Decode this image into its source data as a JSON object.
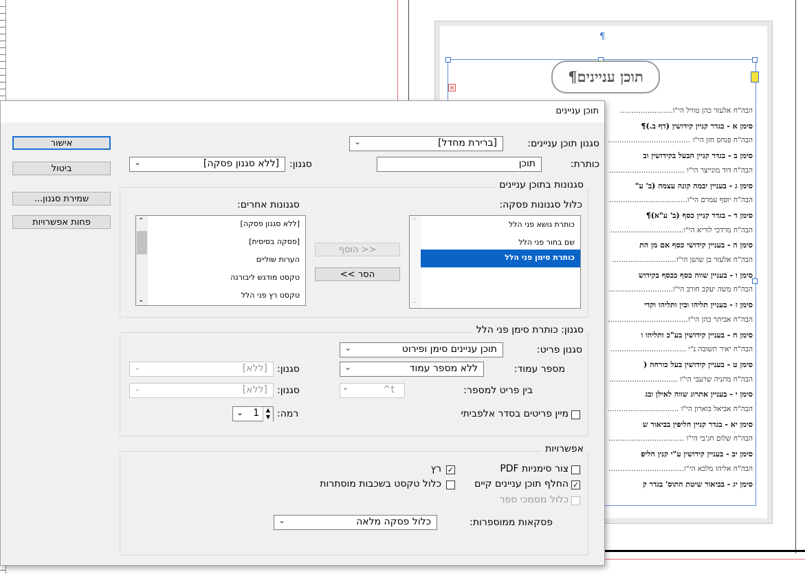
{
  "document": {
    "pilcrow": "¶",
    "title_banner": "תוכן עניינים¶",
    "toc_lines": [
      {
        "kind": "person",
        "text": "הבה\"ח אלעזר כהן טוויל הי\"ו......................."
      },
      {
        "kind": "chapter",
        "text": "סימן א - בגדר קניין קידושין (דף ב.)¶"
      },
      {
        "kind": "person",
        "text": "הבה\"ח פנחס חזן הי\"ו ....................................."
      },
      {
        "kind": "chapter",
        "text": "סימן ב - בגדר קניין הבעל בקידושין וב"
      },
      {
        "kind": "person",
        "text": "הבה\"ח דוד מונייצר הי\"ו .................................."
      },
      {
        "kind": "chapter",
        "text": "סימן ג - בעניין יבמה קונה עצמה (ב' ע\""
      },
      {
        "kind": "person",
        "text": "הבה\"ח יוסף עמרם הי\"ו...................................."
      },
      {
        "kind": "chapter",
        "text": "סימן ד - בגדר קניין כסף (ב' ע\"א)¶"
      },
      {
        "kind": "person",
        "text": "הבה\"ח מרדכי לוריא הי\"ו................................"
      },
      {
        "kind": "chapter",
        "text": "סימן ה - בעניין קידושי כסף אם מן הת"
      },
      {
        "kind": "person",
        "text": "הבה\"ח אלעזר בן שושן הי\"ו............................"
      },
      {
        "kind": "chapter",
        "text": "סימן ו - בעניין שווה כסף ככסף בקידוש"
      },
      {
        "kind": "person",
        "text": "הבה\"ח משה יעקב חורב הי\"ו............................"
      },
      {
        "kind": "chapter",
        "text": "סימן ז - בעניין תליהו ובין ותליהו וקדי"
      },
      {
        "kind": "person",
        "text": "הבה\"ח אביתר כהן הי\"ו..................................."
      },
      {
        "kind": "chapter",
        "text": "סימן ח - בעניין קידושין בע\"כ ותליהו ו"
      },
      {
        "kind": "person",
        "text": "הבה\"ח יאיר תשובה נ\"י ................................."
      },
      {
        "kind": "chapter",
        "text": "סימן ט - בעניין קידושין בעל כורחה ("
      },
      {
        "kind": "person",
        "text": "הבה\"ח מתניה שרעבי הי\"ו ..............................."
      },
      {
        "kind": "chapter",
        "text": "סימן י - בעניין אתרוג שווה לאילן ובג"
      },
      {
        "kind": "person",
        "text": "הבה\"ח אביאל בוארון הי\"ו ..............................."
      },
      {
        "kind": "chapter",
        "text": "סימן יא - בגדר קניין חליפין בביאור ש"
      },
      {
        "kind": "person",
        "text": "הבה\"ח שלום חג'בי הי\"ו ..................................."
      },
      {
        "kind": "chapter",
        "text": "סימן יב - בעניין קידושין ע\"י קנין חליפ"
      },
      {
        "kind": "person",
        "text": "הבה\"ח אליהו מלכא הי\"ו................................."
      },
      {
        "kind": "chapter",
        "text": "סימן יג - בביאור שיטת התוס' בגדר ק"
      }
    ]
  },
  "dialog": {
    "title": "תוכן עניינים",
    "buttons": {
      "ok": "אישור",
      "cancel": "ביטול",
      "save_style": "שמירת סגנון...",
      "fewer_options": "פחות אפשרויות",
      "add": "<< הוסף",
      "remove": "הסר >>"
    },
    "toc_style": {
      "label": "סגנון תוכן עניינים:",
      "value": "[ברירת מחדל]"
    },
    "title_field": {
      "label": "כותרת:",
      "value": "תוכן"
    },
    "title_style": {
      "label": "סגנון:",
      "value": "[ללא סגנון פסקה]"
    },
    "styles_group": {
      "title": "סגנונות בתוכן עניינים",
      "include_label": "כלול סגנונות פסקה:",
      "other_label": "סגנונות אחרים:",
      "include_items": [
        "כותרת נושא פני הלל",
        "שם בחור פני הלל",
        "כותרת סימן פני הלל"
      ],
      "include_selected_index": 2,
      "other_items": [
        "[ללא סגנון פסקה]",
        "[פסקה בסיסית]",
        "הערות שוליים",
        "טקסט מודגש ליבורנה",
        "טקסט רץ פני הלל"
      ]
    },
    "style_group": {
      "title": "סגנון: כותרת סימן פני הלל",
      "entry_style_label": "סגנון פריט:",
      "entry_style_value": "תוכן עניינים סימן ופירוט",
      "page_number_label": "מספר עמוד:",
      "page_number_value": "ללא מספר עמוד",
      "page_number_style_label": "סגנון:",
      "page_number_style_value": "[ללא]",
      "between_label": "בין פריט למספר:",
      "between_value": "^t",
      "between_style_label": "סגנון:",
      "between_style_value": "[ללא]",
      "sort_label": "מיין פריטים בסדר אלפביתי",
      "level_label": "רמה:",
      "level_value": "1"
    },
    "options_group": {
      "title": "אפשרויות",
      "pdf_bookmarks_label": "צור סימניות PDF",
      "run_in_label": "רץ",
      "replace_label": "החלף תוכן עניינים קיים",
      "hidden_layers_label": "כלול טקסט בשכבות מוסתרות",
      "book_docs_label": "כלול מסמכי ספר",
      "numbered_label": "פסקאות ממוספרות:",
      "numbered_value": "כלול פסקה מלאה"
    },
    "icons": {
      "dropdown": "chevron-down-icon",
      "check": "✓",
      "scroll_up": "▲",
      "scroll_down": "▼"
    }
  }
}
